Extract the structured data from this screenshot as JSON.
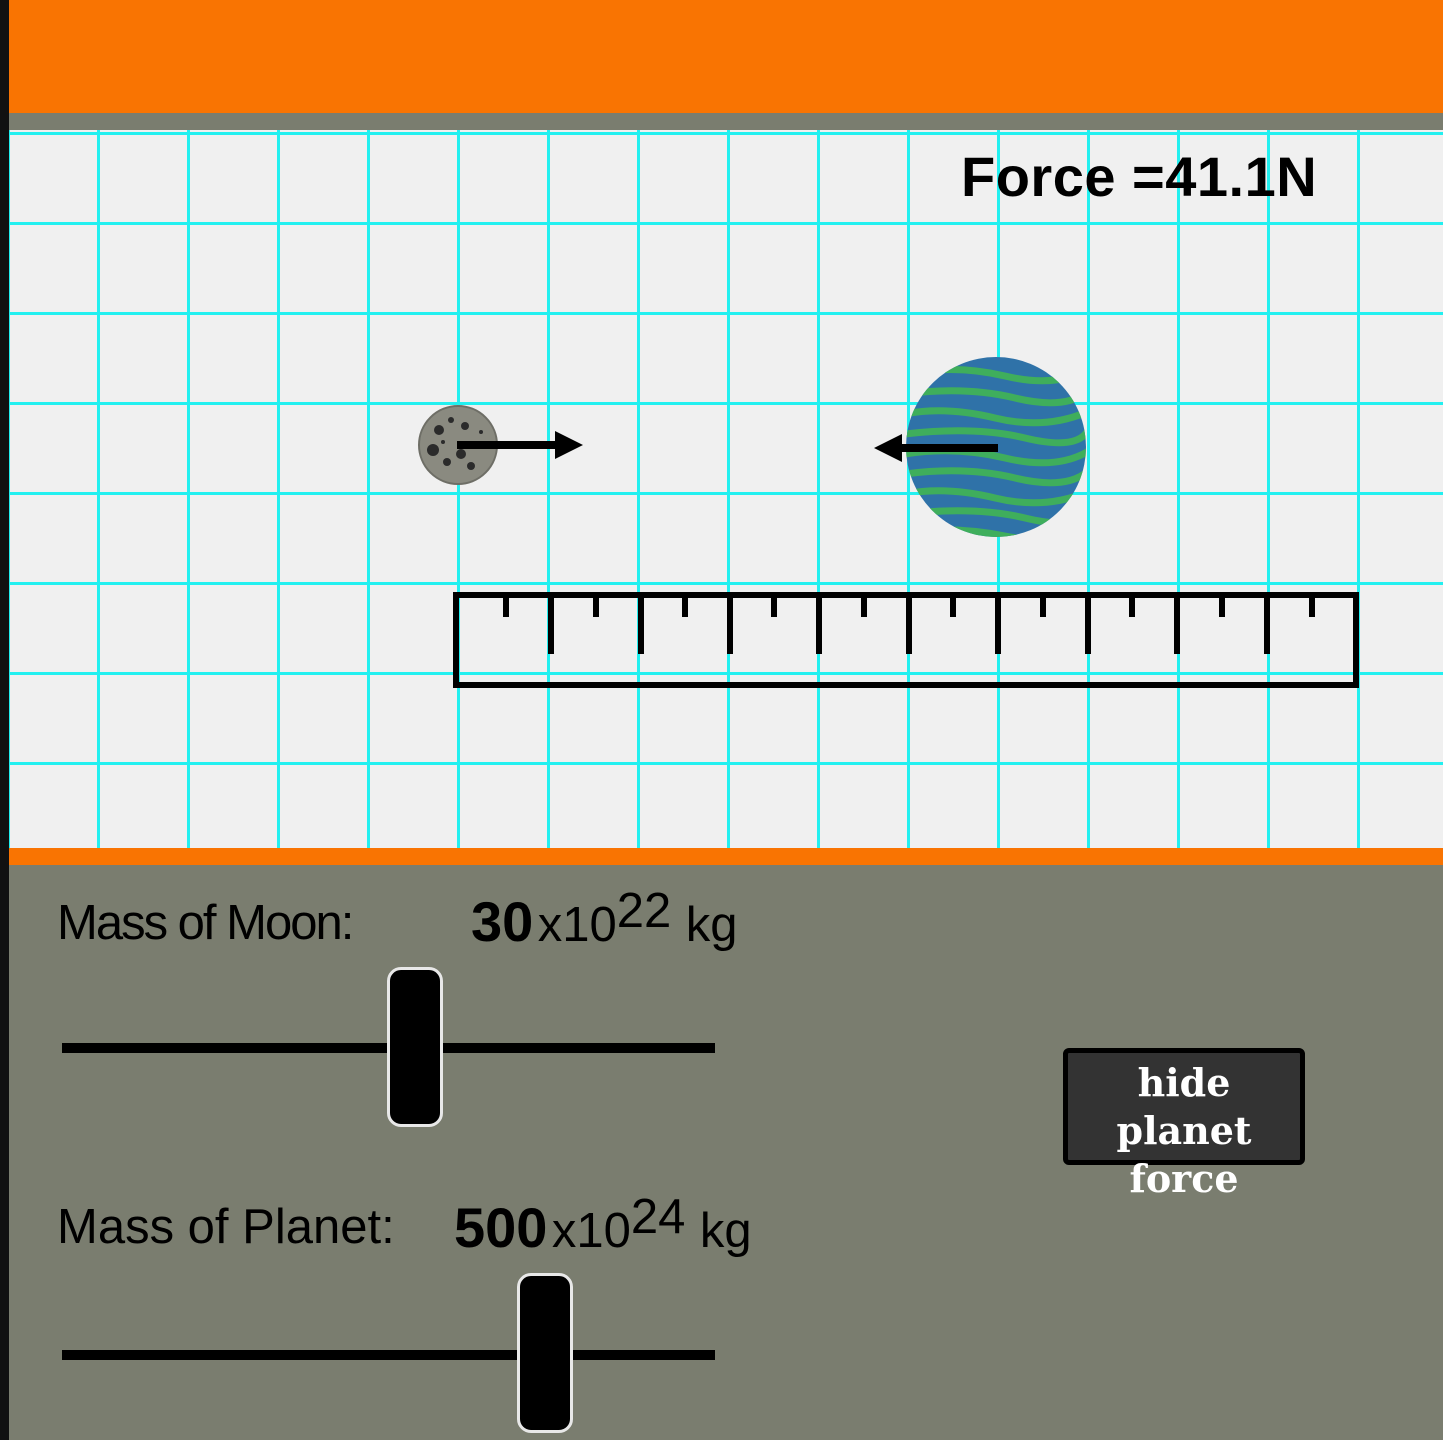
{
  "sim": {
    "force_label": "Force =",
    "force_value": "41.1",
    "force_unit": "N"
  },
  "controls": {
    "moon": {
      "label": "Mass of Moon:",
      "value": "30",
      "multiplier": "x10",
      "exponent": "22",
      "unit": "kg",
      "slider_position": 0.54
    },
    "planet": {
      "label": "Mass of Planet:",
      "value": "500",
      "multiplier": "x10",
      "exponent": "24",
      "unit": "kg",
      "slider_position": 0.74
    },
    "toggle_button": {
      "line1": "hide",
      "line2": "planet force"
    }
  },
  "colors": {
    "header": "#f97402",
    "grid": "#22f0f0",
    "panel": "#7a7d6f"
  }
}
